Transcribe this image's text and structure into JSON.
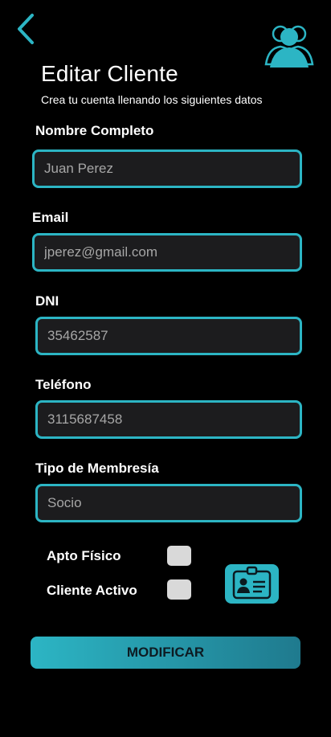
{
  "header": {
    "title": "Editar Cliente",
    "subtitle": "Crea tu cuenta llenando los siguientes datos"
  },
  "fields": {
    "nombre": {
      "label": "Nombre Completo",
      "value": "Juan Perez"
    },
    "email": {
      "label": "Email",
      "value": "jperez@gmail.com"
    },
    "dni": {
      "label": "DNI",
      "value": "35462587"
    },
    "telefono": {
      "label": "Teléfono",
      "value": "3115687458"
    },
    "membresia": {
      "label": "Tipo de Membresía",
      "value": "Socio"
    }
  },
  "checks": {
    "apto_fisico": {
      "label": "Apto Físico",
      "checked": false
    },
    "cliente_activo": {
      "label": "Cliente Activo",
      "checked": false
    }
  },
  "actions": {
    "submit_label": "MODIFICAR"
  },
  "colors": {
    "accent": "#2cb5c4",
    "background": "#000000",
    "input_bg": "#1c1c1e",
    "checkbox": "#d9d9d9"
  },
  "icons": {
    "back": "chevron-left-icon",
    "users": "users-group-icon",
    "id_card": "id-card-icon"
  }
}
